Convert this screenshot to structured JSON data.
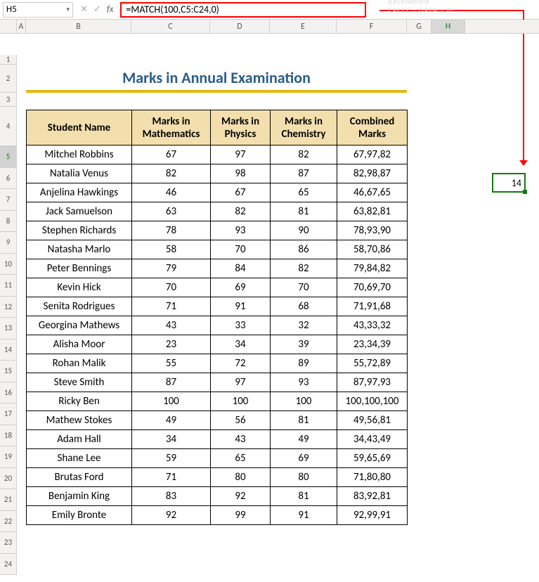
{
  "name_box": "H5",
  "formula": "=MATCH(100,C5:C24,0)",
  "title": "Marks in Annual Examination",
  "columns": [
    "A",
    "B",
    "C",
    "D",
    "E",
    "F",
    "G",
    "H"
  ],
  "rows": [
    "1",
    "2",
    "3",
    "4",
    "5",
    "6",
    "7",
    "8",
    "9",
    "10",
    "11",
    "12",
    "13",
    "14",
    "15",
    "16",
    "17",
    "18",
    "19",
    "20",
    "21",
    "22",
    "23",
    "24"
  ],
  "headers": {
    "name": "Student Name",
    "math": "Marks in Mathematics",
    "phys": "Marks in Physics",
    "chem": "Marks in Chemistry",
    "comb": "Combined Marks"
  },
  "result_h5": "14",
  "watermark": {
    "main": "exceldemy",
    "sub": "EXCEL · DATA · BI"
  },
  "data": [
    {
      "name": "Mitchel Robbins",
      "m": "67",
      "p": "97",
      "c": "82",
      "comb": "67,97,82"
    },
    {
      "name": "Natalia Venus",
      "m": "82",
      "p": "98",
      "c": "87",
      "comb": "82,98,87"
    },
    {
      "name": "Anjelina Hawkings",
      "m": "46",
      "p": "67",
      "c": "65",
      "comb": "46,67,65"
    },
    {
      "name": "Jack Samuelson",
      "m": "63",
      "p": "82",
      "c": "81",
      "comb": "63,82,81"
    },
    {
      "name": "Stephen Richards",
      "m": "78",
      "p": "93",
      "c": "90",
      "comb": "78,93,90"
    },
    {
      "name": "Natasha Marlo",
      "m": "58",
      "p": "70",
      "c": "86",
      "comb": "58,70,86"
    },
    {
      "name": "Peter Bennings",
      "m": "79",
      "p": "84",
      "c": "82",
      "comb": "79,84,82"
    },
    {
      "name": "Kevin Hick",
      "m": "70",
      "p": "69",
      "c": "70",
      "comb": "70,69,70"
    },
    {
      "name": "Senita Rodrigues",
      "m": "71",
      "p": "91",
      "c": "68",
      "comb": "71,91,68"
    },
    {
      "name": "Georgina Mathews",
      "m": "43",
      "p": "33",
      "c": "32",
      "comb": "43,33,32"
    },
    {
      "name": "Alisha Moor",
      "m": "23",
      "p": "34",
      "c": "39",
      "comb": "23,34,39"
    },
    {
      "name": "Rohan Malik",
      "m": "55",
      "p": "72",
      "c": "89",
      "comb": "55,72,89"
    },
    {
      "name": "Steve Smith",
      "m": "87",
      "p": "97",
      "c": "93",
      "comb": "87,97,93"
    },
    {
      "name": "Ricky Ben",
      "m": "100",
      "p": "100",
      "c": "100",
      "comb": "100,100,100"
    },
    {
      "name": "Mathew Stokes",
      "m": "49",
      "p": "56",
      "c": "81",
      "comb": "49,56,81"
    },
    {
      "name": "Adam Hall",
      "m": "34",
      "p": "43",
      "c": "49",
      "comb": "34,43,49"
    },
    {
      "name": "Shane Lee",
      "m": "59",
      "p": "65",
      "c": "69",
      "comb": "59,65,69"
    },
    {
      "name": "Brutas Ford",
      "m": "71",
      "p": "80",
      "c": "80",
      "comb": "71,80,80"
    },
    {
      "name": "Benjamin King",
      "m": "83",
      "p": "92",
      "c": "81",
      "comb": "83,92,81"
    },
    {
      "name": "Emily Bronte",
      "m": "92",
      "p": "99",
      "c": "91",
      "comb": "92,99,91"
    }
  ]
}
